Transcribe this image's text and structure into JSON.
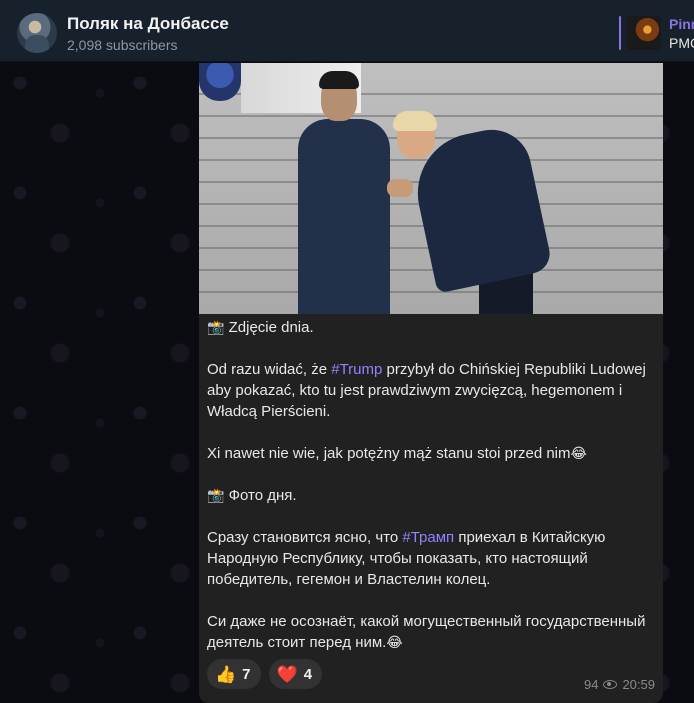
{
  "header": {
    "channel_title": "Поляк на Донбассе",
    "subscribers": "2,098 subscribers",
    "pinned_title": "Pinn",
    "pinned_text": "PMC"
  },
  "message": {
    "photo_alt_icon": "photo",
    "paragraphs": [
      {
        "prefix_emoji": "📸",
        "text": " Zdjęcie dnia."
      },
      {
        "before": "Od razu widać, że ",
        "hashtag": "#Trump",
        "after": " przybył do Chińskiej Republiki Ludowej aby pokazać, kto tu jest prawdziwym zwycięzcą, hegemonem i Władcą Pierścieni."
      },
      {
        "text": "Xi nawet nie wie, jak potężny mąż stanu stoi przed nim",
        "suffix_emoji": "😂"
      },
      {
        "prefix_emoji": "📸",
        "text": " Фото дня."
      },
      {
        "before": "Сразу становится ясно, что ",
        "hashtag": "#Трамп",
        "after": " приехал в Китайскую Народную Республику, чтобы показать, кто настоящий победитель, гегемон и Властелин колец."
      },
      {
        "text": "Си даже не осознаёт, какой могущественный государственный деятель стоит перед ним.",
        "suffix_emoji": "😂"
      }
    ],
    "reactions": [
      {
        "emoji": "👍",
        "count": "7"
      },
      {
        "emoji": "❤️",
        "count": "4"
      }
    ],
    "views": "94",
    "time": "20:59"
  },
  "colors": {
    "header_bg": "#17212b",
    "bubble_bg": "#212121",
    "hashtag": "#8f84ff",
    "accent": "#8774e1"
  }
}
